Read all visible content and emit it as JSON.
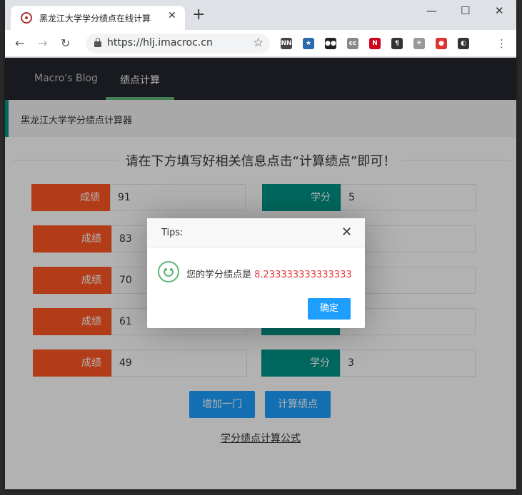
{
  "browser": {
    "tab_title": "黑龙江大学学分绩点在线计算",
    "tab_close": "✕",
    "new_tab": "+",
    "url": "https://hlj.imacroc.cn",
    "window_controls": [
      "—",
      "☐",
      "✕"
    ],
    "extensions": [
      {
        "name": "extension-nn-icon",
        "text": "NN",
        "color": "#444"
      },
      {
        "name": "extension-star-icon",
        "text": "★",
        "color": "#2a6aad"
      },
      {
        "name": "extension-mask-icon",
        "text": "●●",
        "color": "#222"
      },
      {
        "name": "extension-cc-icon",
        "text": "cc",
        "color": "#888"
      },
      {
        "name": "extension-netflix-icon",
        "text": "N",
        "color": "#d0021b"
      },
      {
        "name": "extension-pilcrow-icon",
        "text": "¶",
        "color": "#333"
      },
      {
        "name": "extension-bird-icon",
        "text": "✈",
        "color": "#999"
      },
      {
        "name": "extension-record-icon",
        "text": "●",
        "color": "#d33"
      },
      {
        "name": "extension-avatar-icon",
        "text": "◐",
        "color": "#333"
      }
    ]
  },
  "site": {
    "nav": [
      "Macro's Blog",
      "绩点计算"
    ],
    "quote": "黑龙江大学学分绩点计算器",
    "heading": "请在下方填写好相关信息点击“计算绩点”即可！",
    "score_label": "成绩",
    "credit_label": "学分",
    "rows": [
      {
        "score": "91",
        "credit": "5"
      },
      {
        "score": "83",
        "credit": ""
      },
      {
        "score": "70",
        "credit": ""
      },
      {
        "score": "61",
        "credit": ""
      },
      {
        "score": "49",
        "credit": "3"
      }
    ],
    "add_button": "增加一门",
    "calc_button": "计算绩点",
    "formula_link": "学分绩点计算公式"
  },
  "dialog": {
    "title": "Tips:",
    "close": "✕",
    "message": "您的学分绩点是",
    "value": "8.233333333333333",
    "ok": "确定"
  },
  "colors": {
    "score_label": "#ff5722",
    "credit_label": "#009688",
    "button": "#1e9fff",
    "nav_bg": "#23262e",
    "nav_active": "#5fb878"
  }
}
